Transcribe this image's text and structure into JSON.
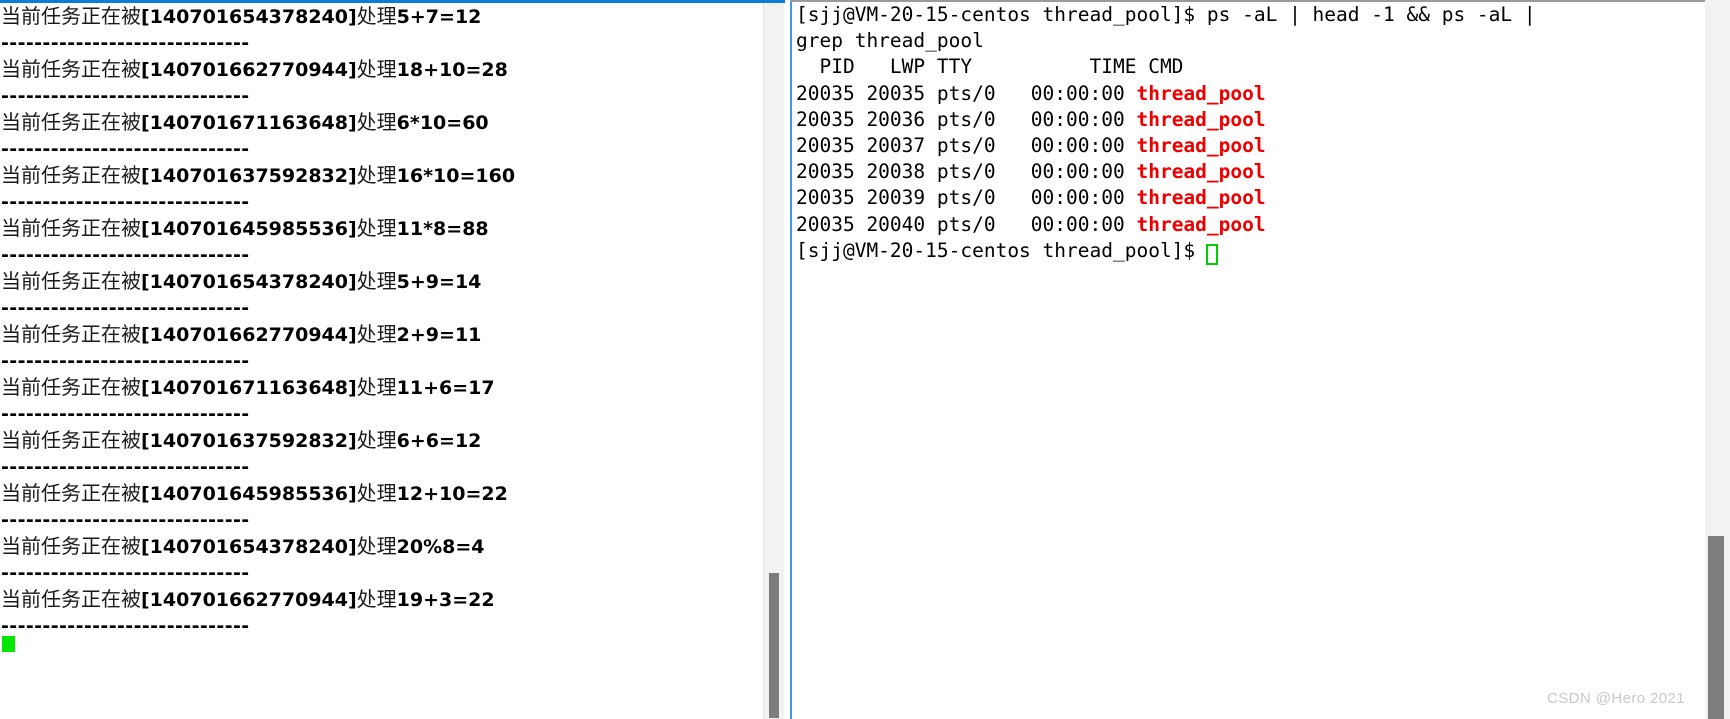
{
  "colors": {
    "left_top_border": "#0c7cd5",
    "terminal_rail": "#3d9be9",
    "cmd_highlight": "#ee0000",
    "cursor_left": "#00e800",
    "cursor_terminal": "#00d000",
    "scrollbar_thumb": "#7d7d7d",
    "scrollbar_track": "#f2f2f2",
    "watermark": "#c8c8c8"
  },
  "left_console": {
    "separator": "------------------------------",
    "prefix_cjk": "当前任务正在被",
    "middle_cjk": "处理",
    "entries": [
      {
        "thread_id": "140701654378240",
        "expr": "5+7=12"
      },
      {
        "thread_id": "140701662770944",
        "expr": "18+10=28"
      },
      {
        "thread_id": "140701671163648",
        "expr": "6*10=60"
      },
      {
        "thread_id": "140701637592832",
        "expr": "16*10=160"
      },
      {
        "thread_id": "140701645985536",
        "expr": "11*8=88"
      },
      {
        "thread_id": "140701654378240",
        "expr": "5+9=14"
      },
      {
        "thread_id": "140701662770944",
        "expr": "2+9=11"
      },
      {
        "thread_id": "140701671163648",
        "expr": "11+6=17"
      },
      {
        "thread_id": "140701637592832",
        "expr": "6+6=12"
      },
      {
        "thread_id": "140701645985536",
        "expr": "12+10=22"
      },
      {
        "thread_id": "140701654378240",
        "expr": "20%8=4"
      },
      {
        "thread_id": "140701662770944",
        "expr": "19+3=22"
      }
    ],
    "lines": [
      "当前任务正在被[140701654378240]处理5+7=12",
      "------------------------------",
      "当前任务正在被[140701662770944]处理18+10=28",
      "------------------------------",
      "当前任务正在被[140701671163648]处理6*10=60",
      "------------------------------",
      "当前任务正在被[140701637592832]处理16*10=160",
      "------------------------------",
      "当前任务正在被[140701645985536]处理11*8=88",
      "------------------------------",
      "当前任务正在被[140701654378240]处理5+9=14",
      "------------------------------",
      "当前任务正在被[140701662770944]处理2+9=11",
      "------------------------------",
      "当前任务正在被[140701671163648]处理11+6=17",
      "------------------------------",
      "当前任务正在被[140701637592832]处理6+6=12",
      "------------------------------",
      "当前任务正在被[140701645985536]处理12+10=22",
      "------------------------------",
      "当前任务正在被[140701654378240]处理20%8=4",
      "------------------------------",
      "当前任务正在被[140701662770944]处理19+3=22",
      "------------------------------"
    ]
  },
  "terminal": {
    "prompt": "[sjj@VM-20-15-centos thread_pool]$ ",
    "command": "ps -aL | head -1 && ps -aL | grep thread_pool",
    "wrapped_command_line_1": "[sjj@VM-20-15-centos thread_pool]$ ps -aL | head -1 && ps -aL |",
    "wrapped_command_line_2": "grep thread_pool",
    "table_header": "  PID   LWP TTY          TIME CMD",
    "columns": [
      "PID",
      "LWP",
      "TTY",
      "TIME",
      "CMD"
    ],
    "rows": [
      {
        "pid": "20035",
        "lwp": "20035",
        "tty": "pts/0",
        "time": "00:00:00",
        "cmd": "thread_pool"
      },
      {
        "pid": "20035",
        "lwp": "20036",
        "tty": "pts/0",
        "time": "00:00:00",
        "cmd": "thread_pool"
      },
      {
        "pid": "20035",
        "lwp": "20037",
        "tty": "pts/0",
        "time": "00:00:00",
        "cmd": "thread_pool"
      },
      {
        "pid": "20035",
        "lwp": "20038",
        "tty": "pts/0",
        "time": "00:00:00",
        "cmd": "thread_pool"
      },
      {
        "pid": "20035",
        "lwp": "20039",
        "tty": "pts/0",
        "time": "00:00:00",
        "cmd": "thread_pool"
      },
      {
        "pid": "20035",
        "lwp": "20040",
        "tty": "pts/0",
        "time": "00:00:00",
        "cmd": "thread_pool"
      }
    ],
    "row_prefixes": [
      "20035 20035 pts/0   00:00:00 ",
      "20035 20036 pts/0   00:00:00 ",
      "20035 20037 pts/0   00:00:00 ",
      "20035 20038 pts/0   00:00:00 ",
      "20035 20039 pts/0   00:00:00 ",
      "20035 20040 pts/0   00:00:00 "
    ],
    "final_prompt": "[sjj@VM-20-15-centos thread_pool]$ "
  },
  "watermark": {
    "text": "CSDN @Hero 2021"
  }
}
